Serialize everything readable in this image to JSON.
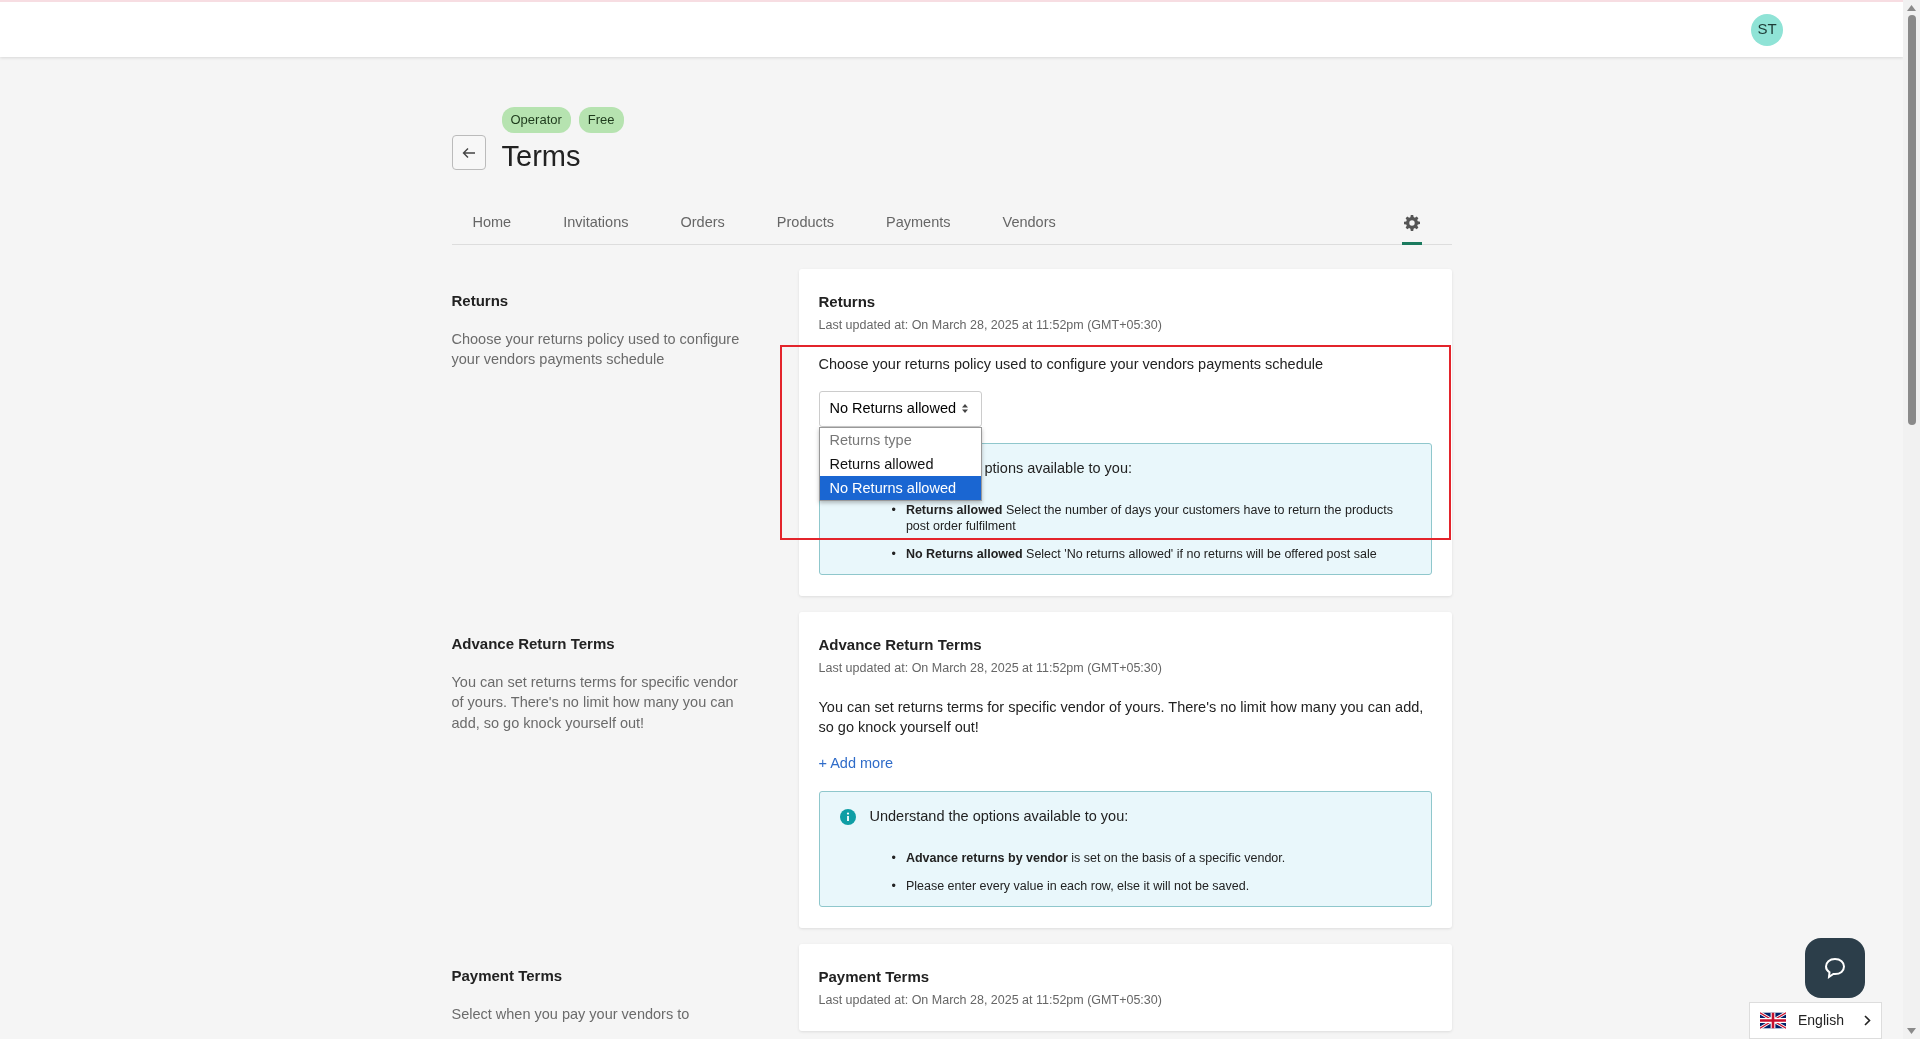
{
  "header": {
    "avatar": "ST"
  },
  "page": {
    "badges": [
      "Operator",
      "Free"
    ],
    "title": "Terms"
  },
  "tabs": [
    {
      "kind": "text",
      "label": "Home",
      "selected": false
    },
    {
      "kind": "text",
      "label": "Invitations",
      "selected": false
    },
    {
      "kind": "text",
      "label": "Orders",
      "selected": false
    },
    {
      "kind": "text",
      "label": "Products",
      "selected": false
    },
    {
      "kind": "text",
      "label": "Payments",
      "selected": false
    },
    {
      "kind": "text",
      "label": "Vendors",
      "selected": false
    },
    {
      "kind": "settings",
      "selected": true
    }
  ],
  "sections": [
    {
      "heading": "Returns",
      "description": "Choose your returns policy used to configure your vendors payments schedule",
      "highlighted": true,
      "card": {
        "title": "Returns",
        "updated": "Last updated at: On March 28, 2025 at 11:52pm (GMT+05:30)",
        "text": "Choose your returns policy used to configure your vendors payments schedule",
        "select": {
          "value": "No Returns allowed",
          "expanded": true,
          "options": [
            {
              "label": "Returns type",
              "disabled": true,
              "selected": false
            },
            {
              "label": "Returns allowed",
              "disabled": false,
              "selected": false
            },
            {
              "label": "No Returns allowed",
              "disabled": false,
              "selected": true
            }
          ]
        },
        "info": {
          "intro": "ptions available to you:",
          "items": [
            {
              "bullet": "•",
              "text": "**Returns allowed** Select the number of days your customers have to return the products post order fulfilment"
            },
            {
              "bullet": "•",
              "text": "**No Returns allowed** Select 'No returns allowed' if no returns will be offered post sale"
            }
          ]
        }
      }
    },
    {
      "heading": "Advance Return Terms",
      "description": "You can set returns terms for specific vendor of yours. There's no limit how many you can add, so go knock yourself out!",
      "card": {
        "title": "Advance Return Terms",
        "updated": "Last updated at: On March 28, 2025 at 11:52pm (GMT+05:30)",
        "text": "You can set returns terms for specific vendor of yours. There's no limit how many you can add, so go knock yourself out!",
        "link": "+ Add more",
        "info": {
          "icon": true,
          "intro": "Understand the options available to you:",
          "items": [
            {
              "bullet": "•",
              "text": "**Advance returns by vendor** is set on the basis of a specific vendor."
            },
            {
              "bullet": "•",
              "text": "Please enter every value in each row, else it will not be saved."
            }
          ]
        }
      }
    },
    {
      "heading": "Payment Terms",
      "description": "Select when you pay your vendors to",
      "card": {
        "title": "Payment Terms",
        "updated": "Last updated at: On March 28, 2025 at 11:52pm (GMT+05:30)"
      }
    }
  ],
  "language": {
    "label": "English"
  }
}
